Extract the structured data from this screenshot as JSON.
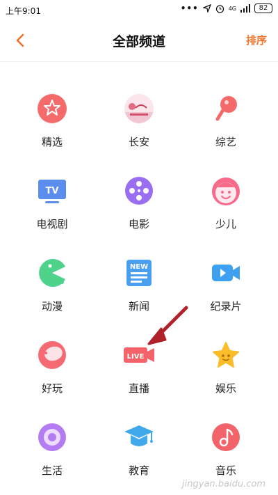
{
  "status_bar": {
    "time": "上午9:01",
    "signal": "4G",
    "battery": "82"
  },
  "header": {
    "title": "全部频道",
    "sort_label": "排序"
  },
  "channels": [
    {
      "label": "精选",
      "icon": "featured-icon",
      "color": "#f56a6a"
    },
    {
      "label": "长安",
      "icon": "changan-thumbnail-icon",
      "color": "#e85a7a"
    },
    {
      "label": "综艺",
      "icon": "microphone-icon",
      "color": "#f46a6a"
    },
    {
      "label": "电视剧",
      "icon": "tv-icon",
      "color": "#5b8def"
    },
    {
      "label": "电影",
      "icon": "film-reel-icon",
      "color": "#9a6ef0"
    },
    {
      "label": "少儿",
      "icon": "kid-face-icon",
      "color": "#f86a8a"
    },
    {
      "label": "动漫",
      "icon": "pacman-icon",
      "color": "#4fd28a"
    },
    {
      "label": "新闻",
      "icon": "newspaper-icon",
      "color": "#4a9ff0"
    },
    {
      "label": "纪录片",
      "icon": "video-camera-icon",
      "color": "#3ea0f0"
    },
    {
      "label": "好玩",
      "icon": "fun-bubble-icon",
      "color": "#f56a72"
    },
    {
      "label": "直播",
      "icon": "live-camera-icon",
      "color": "#f5636a"
    },
    {
      "label": "娱乐",
      "icon": "star-icon",
      "color": "#f9bd2a"
    },
    {
      "label": "生活",
      "icon": "life-circle-icon",
      "color": "#b47cf2"
    },
    {
      "label": "教育",
      "icon": "graduation-cap-icon",
      "color": "#3fa9ec"
    },
    {
      "label": "音乐",
      "icon": "music-note-icon",
      "color": "#f3636a"
    }
  ],
  "annotation": {
    "color": "#b0222a"
  },
  "watermark": "jingyan.baidu.com"
}
